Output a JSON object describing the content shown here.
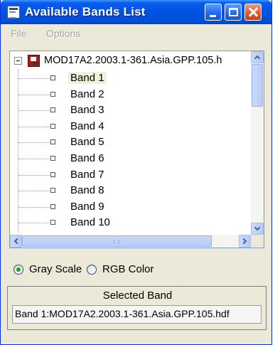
{
  "window": {
    "title": "Available Bands List"
  },
  "menu": {
    "file": "File",
    "options": "Options"
  },
  "tree": {
    "root_label": "MOD17A2.2003.1-361.Asia.GPP.105.h",
    "bands": [
      "Band 1",
      "Band 2",
      "Band 3",
      "Band 4",
      "Band 5",
      "Band 6",
      "Band 7",
      "Band 8",
      "Band 9",
      "Band 10"
    ],
    "selected_index": 0
  },
  "radio": {
    "gray_label": "Gray Scale",
    "rgb_label": "RGB Color",
    "selected": "gray"
  },
  "selected_band": {
    "title": "Selected Band",
    "value": "Band 1:MOD17A2.2003.1-361.Asia.GPP.105.hdf"
  },
  "colors": {
    "titlebar": "#0053e1",
    "window_bg": "#ece9d8",
    "selection": "#f3f0da",
    "radio_dot": "#21a121"
  },
  "icons": {
    "app": "app-icon",
    "minimize": "minimize-icon",
    "maximize": "maximize-icon",
    "close": "close-icon",
    "expander": "collapse-icon",
    "file": "hdf-file-icon",
    "leaf": "band-leaf-icon"
  }
}
